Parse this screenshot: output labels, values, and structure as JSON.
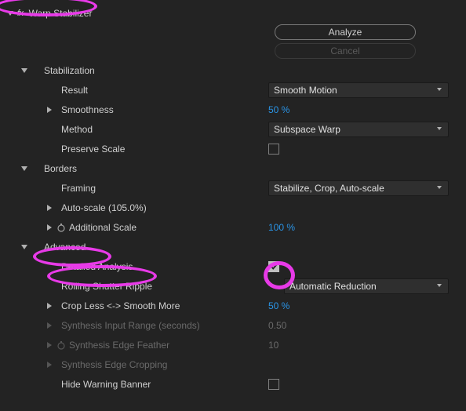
{
  "effect": {
    "fx_prefix": "fx",
    "name": "Warp Stabilizer"
  },
  "buttons": {
    "analyze": "Analyze",
    "cancel": "Cancel"
  },
  "sections": {
    "stabilization": {
      "label": "Stabilization"
    },
    "borders": {
      "label": "Borders"
    },
    "advanced": {
      "label": "Advanced"
    }
  },
  "params": {
    "result": {
      "label": "Result",
      "value": "Smooth Motion"
    },
    "smoothness": {
      "label": "Smoothness",
      "value": "50 %"
    },
    "method": {
      "label": "Method",
      "value": "Subspace Warp"
    },
    "preserve_scale": {
      "label": "Preserve Scale",
      "checked": false
    },
    "framing": {
      "label": "Framing",
      "value": "Stabilize, Crop, Auto-scale"
    },
    "auto_scale": {
      "label": "Auto-scale (105.0%)"
    },
    "additional_scale": {
      "label": "Additional Scale",
      "value": "100 %"
    },
    "detailed_analysis": {
      "label": "Detailed Analysis",
      "checked": true
    },
    "rolling_shutter": {
      "label": "Rolling Shutter Ripple",
      "value": "Automatic Reduction"
    },
    "crop_smooth": {
      "label": "Crop Less <-> Smooth More",
      "value": "50 %"
    },
    "synth_range": {
      "label": "Synthesis Input Range (seconds)",
      "value": "0.50"
    },
    "synth_feather": {
      "label": "Synthesis Edge Feather",
      "value": "10"
    },
    "synth_cropping": {
      "label": "Synthesis Edge Cropping"
    },
    "hide_warning": {
      "label": "Hide Warning Banner",
      "checked": false
    }
  }
}
